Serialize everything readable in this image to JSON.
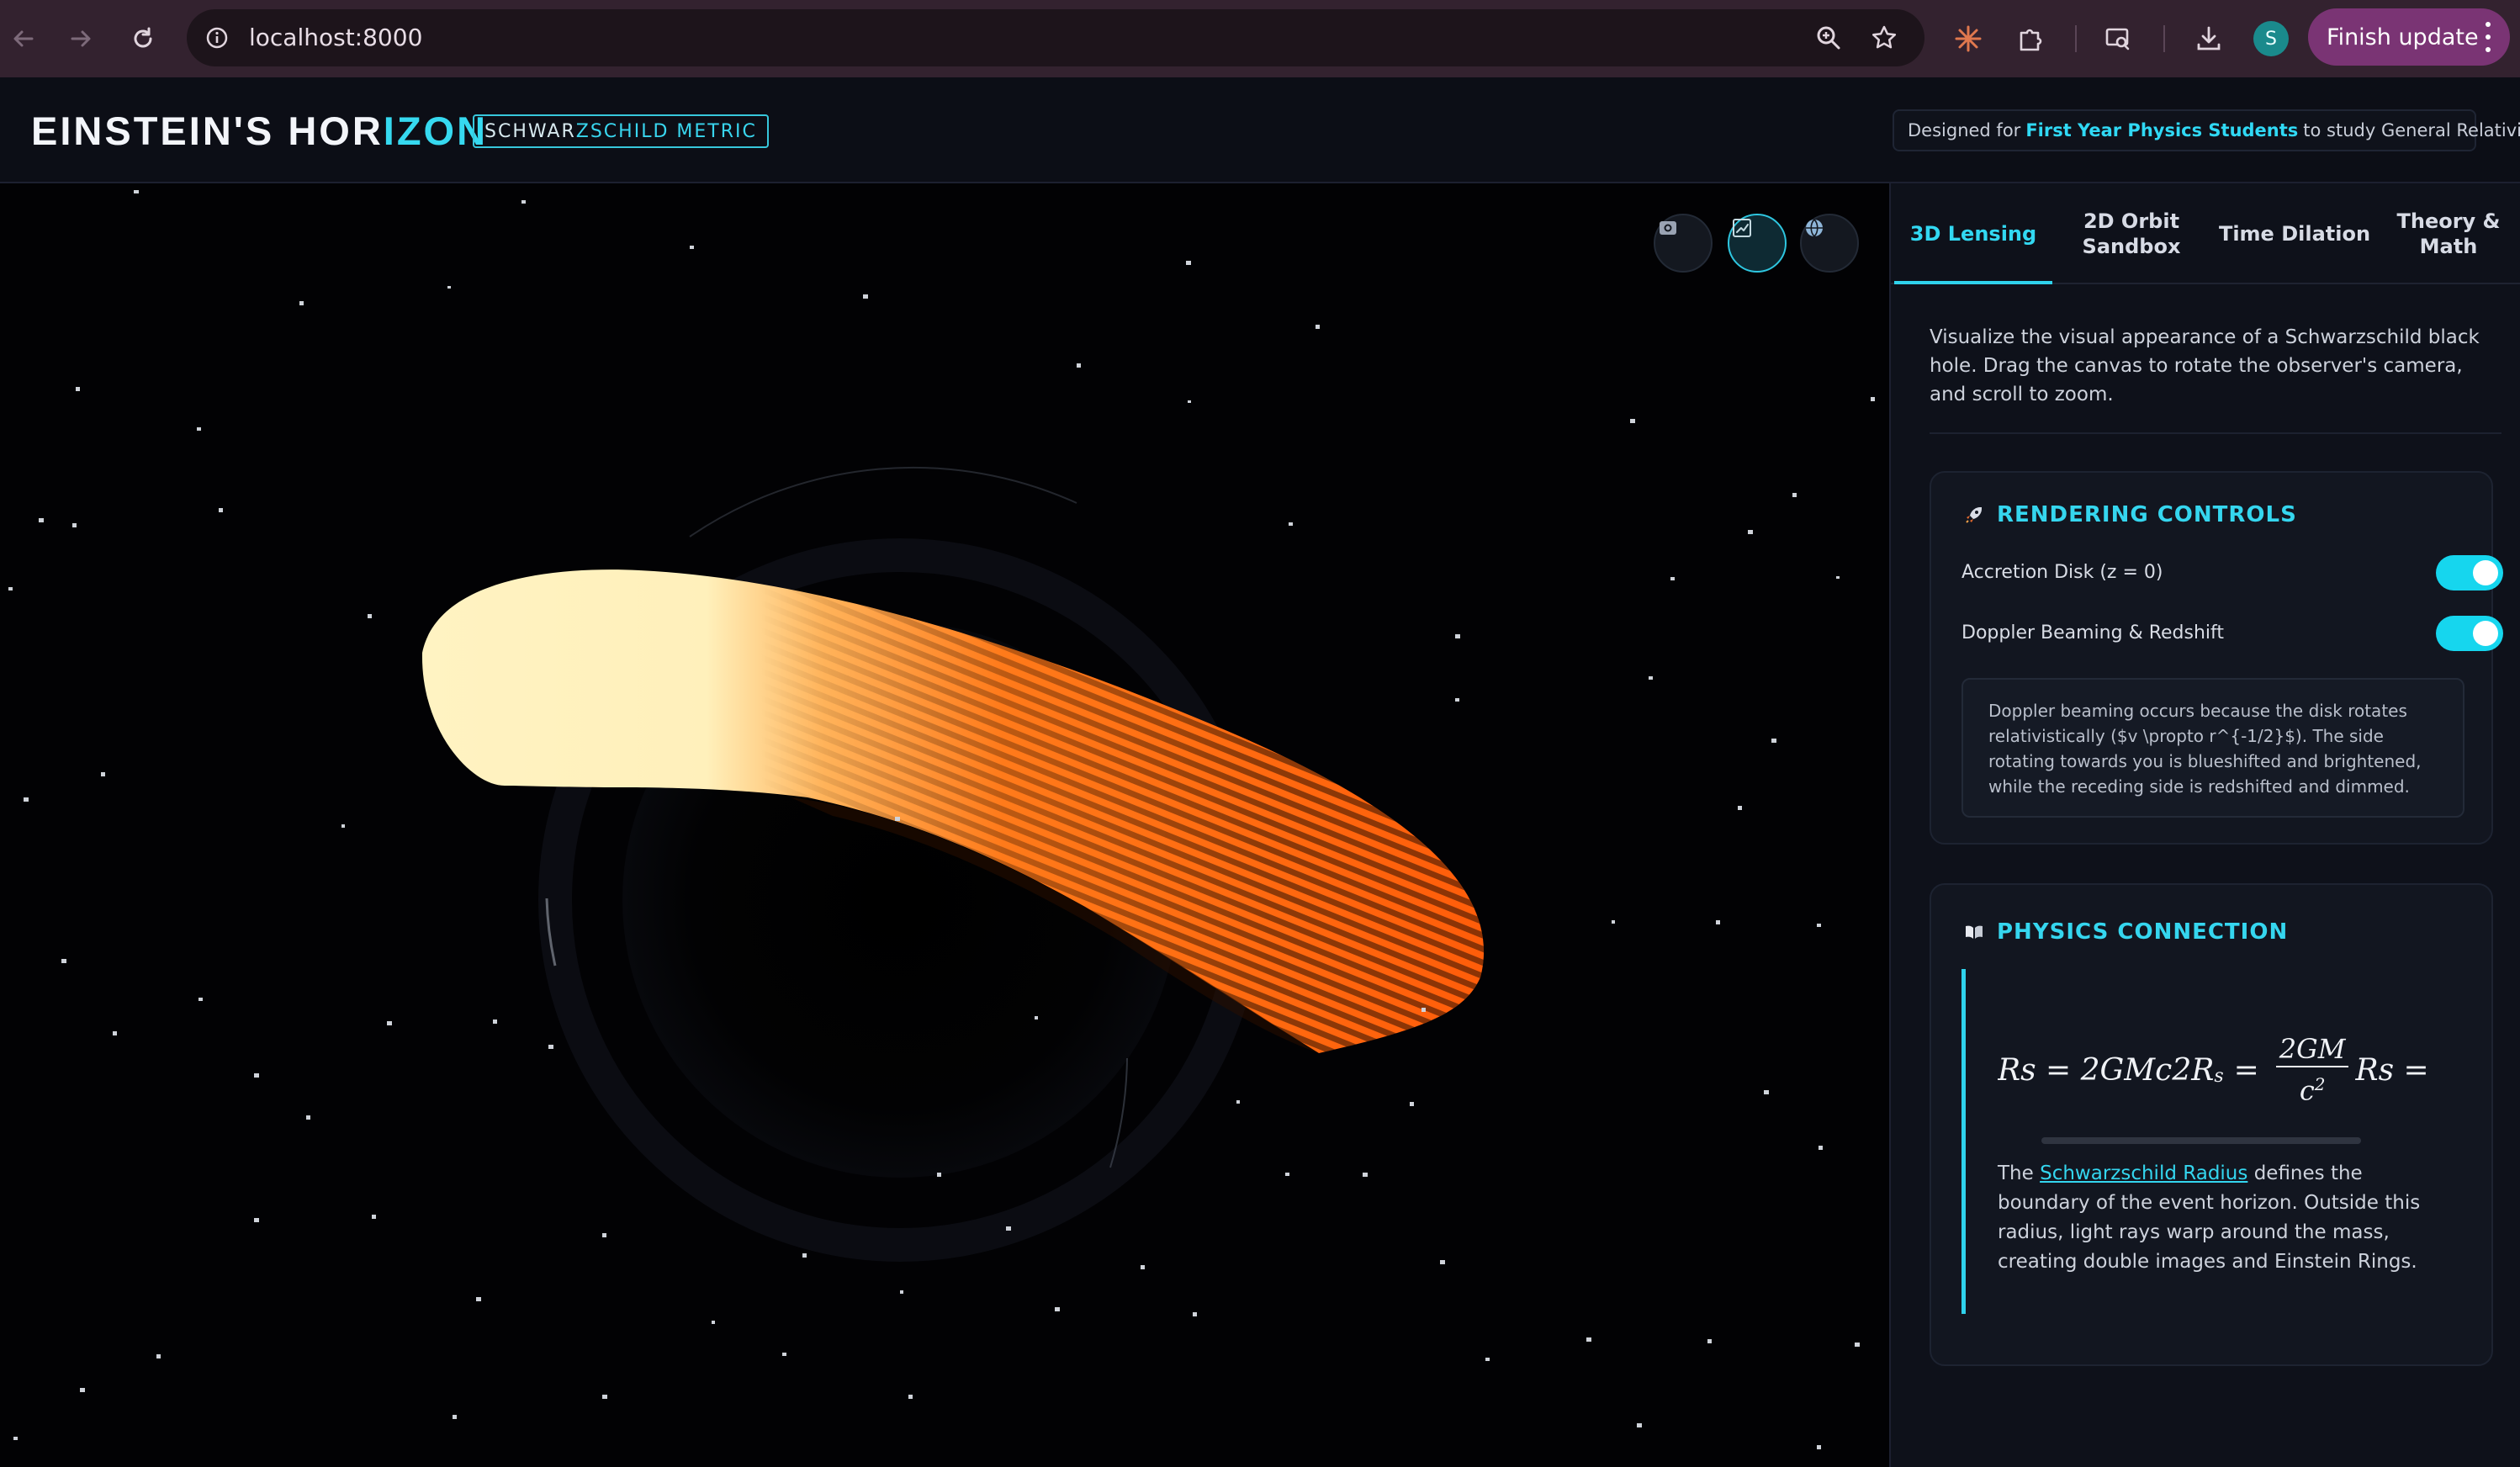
{
  "browser": {
    "url": "localhost:8000",
    "profile_initial": "S",
    "update_button": "Finish update"
  },
  "header": {
    "title_part1": "EINSTEIN'S HOR",
    "title_part2": "IZON",
    "badge_part1": "SCHWAR",
    "badge_part2": "ZSCHILD METRIC",
    "designed_prefix": "Designed for",
    "designed_highlight": "First Year Physics Students",
    "designed_suffix": "to study General Relativity."
  },
  "tabs": [
    {
      "label": "3D Lensing",
      "active": true
    },
    {
      "label": "2D Orbit Sandbox",
      "active": false
    },
    {
      "label": "Time Dilation",
      "active": false
    },
    {
      "label": "Theory & Math",
      "active": false
    }
  ],
  "tab_lines": {
    "orbit_1": "2D Orbit",
    "orbit_2": "Sandbox",
    "theory_1": "Theory &",
    "theory_2": "Math"
  },
  "intro_text": "Visualize the visual appearance of a Schwarzschild black hole. Drag the canvas to rotate the observer's camera, and scroll to zoom.",
  "rendering_controls": {
    "title": "RENDERING CONTROLS",
    "icon": "rocket-icon",
    "toggles": [
      {
        "label": "Accretion Disk (z = 0)",
        "on": true
      },
      {
        "label": "Doppler Beaming & Redshift",
        "on": true
      }
    ],
    "info": "Doppler beaming occurs because the disk rotates relativistically ($v \\propto r^{-1/2}$). The side rotating towards you is blueshifted and brightened, while the receding side is redshifted and dimmed."
  },
  "physics_connection": {
    "title": "PHYSICS CONNECTION",
    "icon": "book-icon",
    "equation_raw": "Rs = 2GMc2R",
    "equation_sub": "s",
    "equation_eq": "=",
    "frac_num": "2GM",
    "frac_den": "c",
    "frac_den_sup": "2",
    "equation_tail": "Rs = c",
    "text_prefix": "The",
    "text_link": "Schwarzschild Radius",
    "text_suffix": "defines the boundary of the event horizon. Outside this radius, light rays warp around the mass, creating double images and Einstein Rings."
  },
  "view_buttons": [
    "camera-view-icon",
    "chart-view-icon",
    "globe-view-icon"
  ],
  "colors": {
    "accent": "#2fd2ec",
    "disk_hot": "#fff3c2",
    "disk_orange": "#ff6a10",
    "browser_update": "#7a3474"
  }
}
